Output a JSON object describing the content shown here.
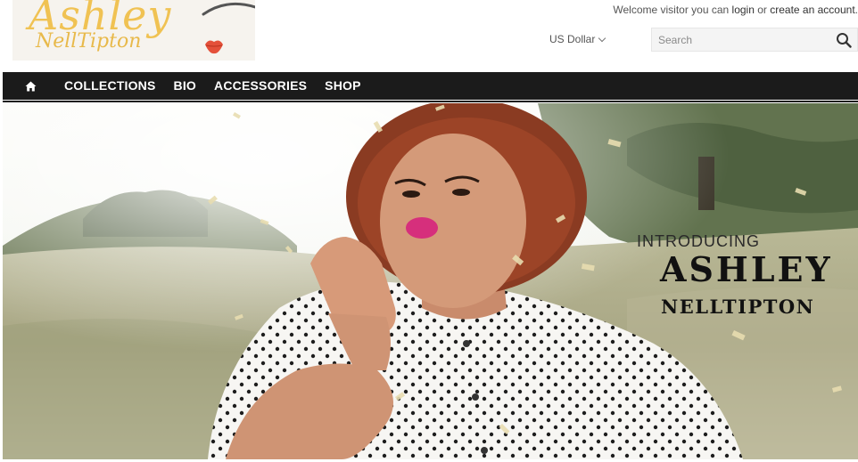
{
  "logo": {
    "line1": "Ashley",
    "line2": "NellTipton"
  },
  "header": {
    "welcome_text": "Welcome visitor you can ",
    "login_link": "login",
    "or_text": " or ",
    "create_account_link": "create an account",
    "welcome_end": ".",
    "currency_label": "US Dollar"
  },
  "search": {
    "placeholder": "Search",
    "value": "",
    "icon": "search-icon"
  },
  "nav": {
    "home_icon": "home-icon",
    "items": [
      "COLLECTIONS",
      "BIO",
      "ACCESSORIES",
      "SHOP"
    ]
  },
  "hero": {
    "intro": "INTRODUCING",
    "name_line1": "ASHLEY",
    "name_line2": "NELLTIPTON"
  },
  "colors": {
    "nav_bg": "#1b1b1b",
    "logo_gold": "#f0c253",
    "lips_red": "#e4503a"
  }
}
